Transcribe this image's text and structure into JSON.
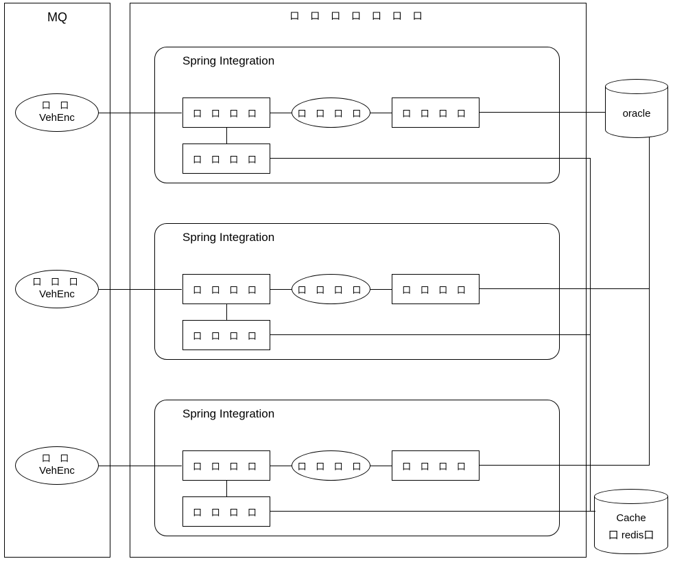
{
  "mq": {
    "title": "MQ"
  },
  "svc": {
    "title": "口 口 口 口 口 口 口"
  },
  "veh": [
    {
      "top": "口 口",
      "bottom": "VehEnc"
    },
    {
      "top": "口 口 口",
      "bottom": "VehEnc"
    },
    {
      "top": "口 口",
      "bottom": "VehEnc"
    }
  ],
  "si": [
    {
      "title": "Spring Integration",
      "box_tl": "口 口 口 口",
      "ell": "口 口 口 口",
      "box_tr": "口 口 口 口",
      "box_bl": "口 口 口 口"
    },
    {
      "title": "Spring Integration",
      "box_tl": "口 口 口 口",
      "ell": "口 口 口 口",
      "box_tr": "口 口 口 口",
      "box_bl": "口 口 口 口"
    },
    {
      "title": "Spring Integration",
      "box_tl": "口 口 口 口",
      "ell": "口 口 口 口",
      "box_tr": "口 口 口 口",
      "box_bl": "口 口 口 口"
    }
  ],
  "oracle": {
    "label": "oracle"
  },
  "cache": {
    "label1": "Cache",
    "label2": "口 redis口"
  }
}
